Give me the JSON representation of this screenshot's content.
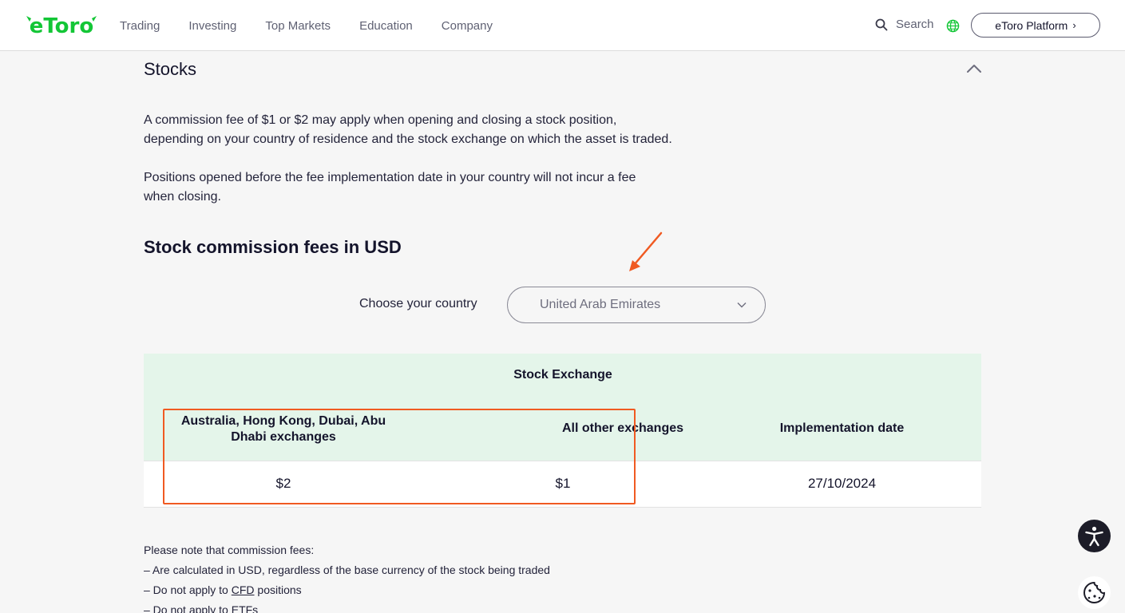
{
  "header": {
    "logo_text": "eToro",
    "nav": [
      "Trading",
      "Investing",
      "Top Markets",
      "Education",
      "Company"
    ],
    "search_label": "Search",
    "platform_button": "eToro Platform"
  },
  "colors": {
    "brand_green": "#13c636",
    "table_header_bg": "#e4f5ea",
    "annotation_orange": "#f05a22"
  },
  "content": {
    "section_title": "Stocks",
    "paragraph1_line1": "A commission fee of $1 or $2 may apply when opening and closing a stock position,",
    "paragraph1_line2": "depending on your country of residence and the stock exchange on which the asset is traded.",
    "paragraph2_line1": "Positions opened before the fee implementation date in your country will not incur a fee",
    "paragraph2_line2": "when closing.",
    "subheading": "Stock commission fees in USD",
    "country_label": "Choose your country",
    "country_selected": "United Arab Emirates"
  },
  "table": {
    "group_header": "Stock Exchange",
    "col_au_line1": "Australia, Hong Kong, Dubai, Abu",
    "col_au_line2": "Dhabi exchanges",
    "col_other": "All other exchanges",
    "col_date": "Implementation date",
    "row": {
      "au": "$2",
      "other": "$1",
      "date": "27/10/2024"
    }
  },
  "notes": {
    "intro": "Please note that commission fees:",
    "item1": "– Are calculated in USD, regardless of the base currency of the stock being traded",
    "item2_prefix": "– Do not apply to ",
    "item2_link": "CFD",
    "item2_suffix": " positions",
    "item3": "– Do not apply to ETFs"
  },
  "icons": {
    "search": "search-icon",
    "globe": "globe-icon",
    "collapse": "chevron-up-icon",
    "dropdown": "chevron-down-icon",
    "accessibility": "accessibility-icon",
    "cookie": "cookie-icon"
  }
}
